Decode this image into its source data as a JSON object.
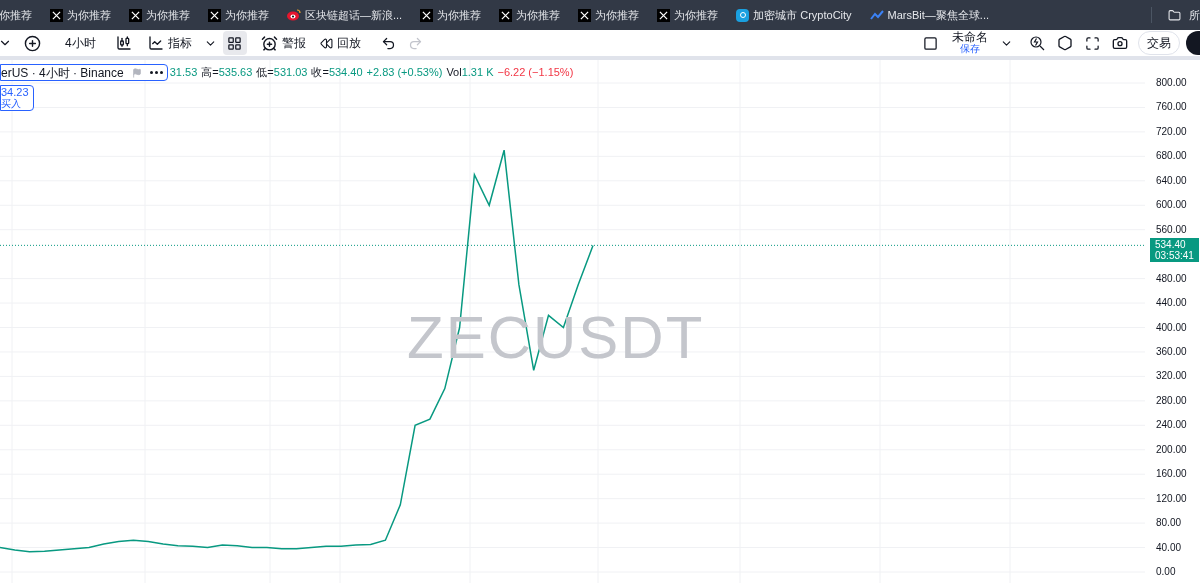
{
  "bookmarks": [
    {
      "kind": "none",
      "label": "你推荐"
    },
    {
      "kind": "x",
      "label": "为你推荐"
    },
    {
      "kind": "x",
      "label": "为你推荐"
    },
    {
      "kind": "x",
      "label": "为你推荐"
    },
    {
      "kind": "weibo",
      "label": "区块链超话—新浪..."
    },
    {
      "kind": "x",
      "label": "为你推荐"
    },
    {
      "kind": "x",
      "label": "为你推荐"
    },
    {
      "kind": "x",
      "label": "为你推荐"
    },
    {
      "kind": "x",
      "label": "为你推荐"
    },
    {
      "kind": "cube",
      "label": "加密城市 CryptoCity"
    },
    {
      "kind": "line",
      "label": "MarsBit—聚焦全球..."
    }
  ],
  "bookmarks_folder": {
    "label": "所"
  },
  "toolbar": {
    "interval": "4小时",
    "indicators": "指标",
    "alerts": "警报",
    "replay": "回放",
    "layout_selected": true,
    "redo_disabled": true,
    "layout_name": "未命名",
    "save": "保存",
    "trade": "交易"
  },
  "legend": {
    "title": "erUS · 4小时 · Binance",
    "open": "31.53",
    "high_label": "高=",
    "high": "535.63",
    "low_label": "低=",
    "low": "531.03",
    "close_label": "收=",
    "close": "534.40",
    "change": "+2.83 (+0.53%)",
    "vol_label": "Vol",
    "vol": "1.31 K",
    "vol_change": "−6.22 (−1.15%)"
  },
  "order": {
    "price": "34.23",
    "side": "买入"
  },
  "watermark": "ZECUSDT",
  "price_axis": {
    "last_price": "534.40",
    "countdown": "03:53:41"
  },
  "chart_data": {
    "type": "line",
    "grid": true,
    "ref_lines": [
      {
        "axis": "y",
        "value": 534.4,
        "color": "#089981"
      }
    ],
    "ylim": [
      0,
      800
    ],
    "yticks": [
      {
        "value": 800,
        "label": "800.00"
      },
      {
        "value": 760,
        "label": "760.00"
      },
      {
        "value": 720,
        "label": "720.00"
      },
      {
        "value": 680,
        "label": "680.00"
      },
      {
        "value": 640,
        "label": "640.00"
      },
      {
        "value": 600,
        "label": "600.00"
      },
      {
        "value": 560,
        "label": "560.00"
      },
      {
        "value": 480,
        "label": "480.00"
      },
      {
        "value": 440,
        "label": "440.00"
      },
      {
        "value": 400,
        "label": "400.00"
      },
      {
        "value": 360,
        "label": "360.00"
      },
      {
        "value": 320,
        "label": "320.00"
      },
      {
        "value": 280,
        "label": "280.00"
      },
      {
        "value": 240,
        "label": "240.00"
      },
      {
        "value": 200,
        "label": "200.00"
      },
      {
        "value": 160,
        "label": "160.00"
      },
      {
        "value": 120,
        "label": "120.00"
      },
      {
        "value": 80,
        "label": "80.00"
      },
      {
        "value": 40,
        "label": "40.00"
      },
      {
        "value": 0,
        "label": "0.00"
      }
    ],
    "series": [
      {
        "color": "#089981",
        "values": [
          40,
          36,
          33,
          34,
          36,
          38,
          40,
          46,
          50,
          52,
          50,
          46,
          43,
          42,
          40,
          44,
          43,
          40,
          40,
          38,
          38,
          40,
          42,
          42,
          44,
          45,
          52,
          110,
          240,
          250,
          300,
          400,
          650,
          600,
          690,
          470,
          330,
          420,
          400,
          470,
          534
        ]
      }
    ]
  }
}
